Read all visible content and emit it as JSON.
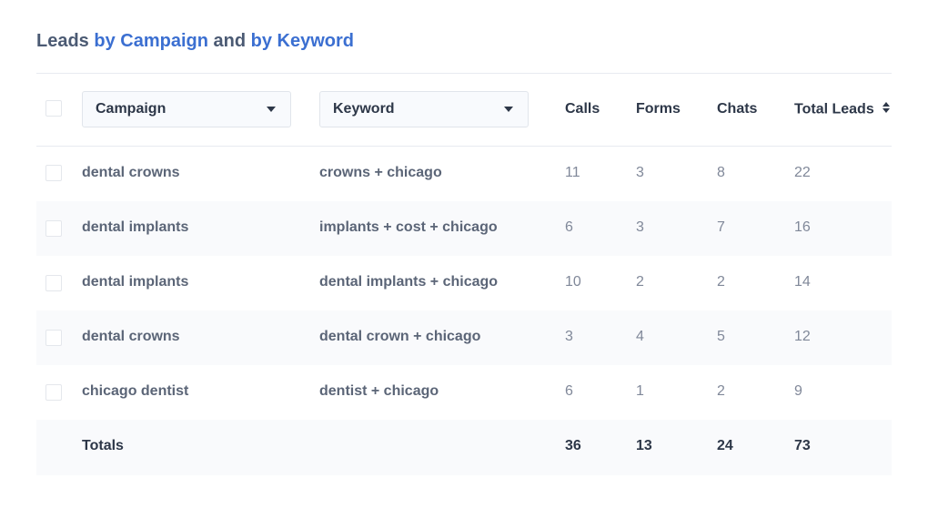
{
  "title": {
    "part1": "Leads ",
    "part2": "by Campaign",
    "part3": " and ",
    "part4": "by Keyword"
  },
  "colors": {
    "accent": "#3b6fd1",
    "text": "#4b5a73"
  },
  "filters": {
    "campaign": {
      "label": "Campaign",
      "icon": "caret-down-icon"
    },
    "keyword": {
      "label": "Keyword",
      "icon": "caret-down-icon"
    }
  },
  "columns": {
    "calls": "Calls",
    "forms": "Forms",
    "chats": "Chats",
    "total_leads": "Total Leads",
    "total_leads_icon": "sort-icon"
  },
  "rows": [
    {
      "campaign": "dental crowns",
      "keyword": "crowns + chicago",
      "calls": "11",
      "forms": "3",
      "chats": "8",
      "total": "22"
    },
    {
      "campaign": "dental implants",
      "keyword": "implants + cost + chicago",
      "calls": "6",
      "forms": "3",
      "chats": "7",
      "total": "16"
    },
    {
      "campaign": "dental implants",
      "keyword": "dental implants + chicago",
      "calls": "10",
      "forms": "2",
      "chats": "2",
      "total": "14"
    },
    {
      "campaign": "dental crowns",
      "keyword": "dental crown + chicago",
      "calls": "3",
      "forms": "4",
      "chats": "5",
      "total": "12"
    },
    {
      "campaign": "chicago dentist",
      "keyword": "dentist + chicago",
      "calls": "6",
      "forms": "1",
      "chats": "2",
      "total": "9"
    }
  ],
  "totals": {
    "label": "Totals",
    "calls": "36",
    "forms": "13",
    "chats": "24",
    "total": "73"
  }
}
